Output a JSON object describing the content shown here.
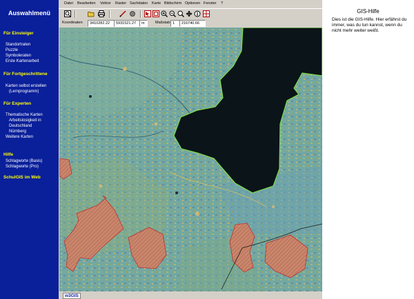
{
  "nav": {
    "title": "Auswahlmenü",
    "sections": [
      {
        "heading": "Für Einsteiger",
        "items": [
          "Standortraten",
          "Puzzle",
          "Symboleraten",
          "Erste Kartenarbeit"
        ]
      },
      {
        "heading": "Für Fortgeschrittene",
        "items": [
          "Karten selbst erstellen",
          "(Lernprogramm)"
        ]
      },
      {
        "heading": "Für Experten",
        "items": [
          "Thematische Karten",
          "Arbeitslosigkeit in",
          "Deutschland",
          "Nürnberg",
          "Weitere Karten"
        ]
      },
      {
        "heading": "Hilfe",
        "items": [
          "Schlagworte (Basis)",
          "Schlagworte (Pro)"
        ]
      },
      {
        "heading": "SchulGIS im Web",
        "items": []
      }
    ]
  },
  "menubar": [
    "Datei",
    "Bearbeiten",
    "Vektor",
    "Raster",
    "Sachdaten",
    "Karte",
    "Bildschirm",
    "Optionen",
    "Fenster",
    "?"
  ],
  "status": {
    "coord_label": "Koordinaten",
    "x": "3410282.22",
    "y": "5931521.27",
    "unit": "m",
    "scale_label": "Maßstab",
    "scale_one": "1",
    "scale_value": "216740.66"
  },
  "bottom_logo": "w3GIS",
  "help": {
    "title": "GIS-Hilfe",
    "text": "Dies ist die GIS-Hilfe. Hier erfährst du immer, was du tun kannst, wenn du nicht mehr weiter weißt."
  },
  "colors": {
    "nav_bg": "#0a1f9a",
    "nav_heading": "#ffff00",
    "nav_text": "#ffffff",
    "water": "#0b1418",
    "land": "#6d9f9c",
    "urban_hatch": "#c06d55"
  },
  "icons": [
    "zoom-icon",
    "open-folder-icon",
    "print-icon",
    "draw-icon",
    "record-icon",
    "select-icon",
    "zoom-in-icon",
    "zoom-out-icon",
    "pan-icon",
    "info-icon",
    "grid-icon"
  ]
}
